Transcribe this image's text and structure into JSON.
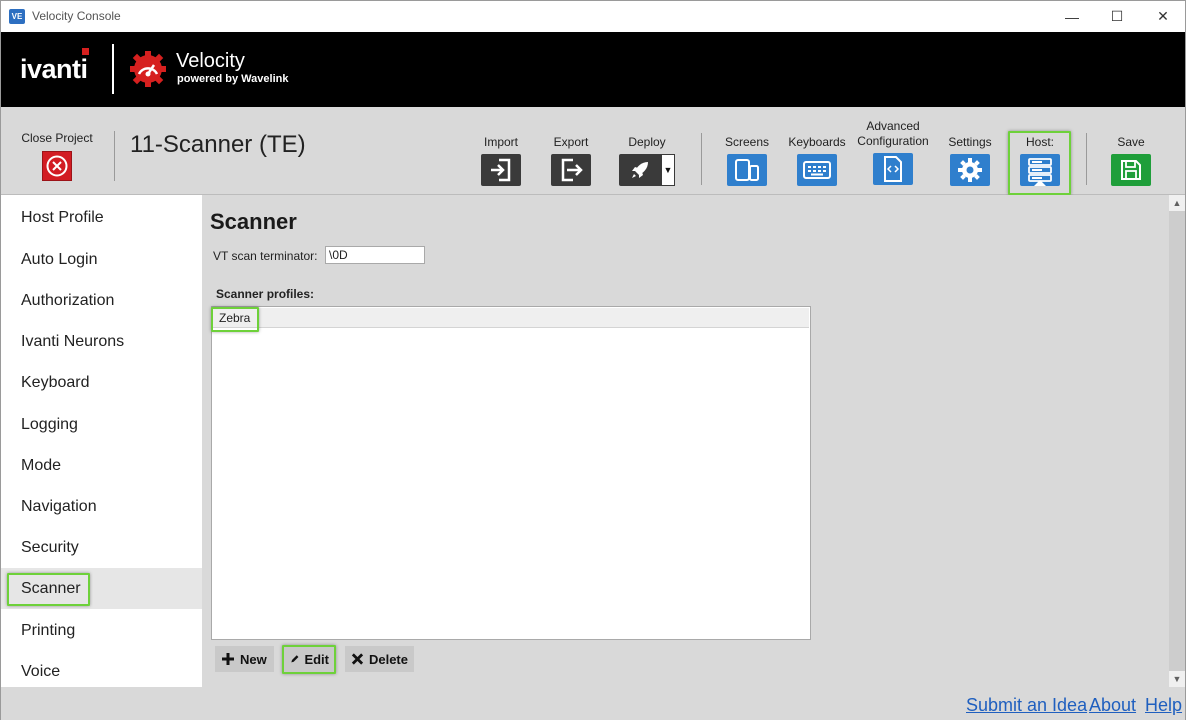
{
  "window": {
    "app_icon_text": "VE",
    "title": "Velocity Console",
    "controls": {
      "minimize": "—",
      "maximize": "☐",
      "close": "✕"
    }
  },
  "banner": {
    "brand": "ivanti",
    "product_name": "Velocity",
    "product_tagline": "powered by Wavelink",
    "accent_color": "#d6201f"
  },
  "toolbar": {
    "close_project_label": "Close Project",
    "project_title": "11-Scanner (TE)",
    "import_label": "Import",
    "export_label": "Export",
    "deploy_label": "Deploy",
    "screens_label": "Screens",
    "keyboards_label": "Keyboards",
    "advanced_label_1": "Advanced",
    "advanced_label_2": "Configuration",
    "settings_label": "Settings",
    "host_label": "Host:",
    "save_label": "Save"
  },
  "sidebar": {
    "items": [
      {
        "label": "Host Profile"
      },
      {
        "label": "Auto Login"
      },
      {
        "label": "Authorization"
      },
      {
        "label": "Ivanti Neurons"
      },
      {
        "label": "Keyboard"
      },
      {
        "label": "Logging"
      },
      {
        "label": "Mode"
      },
      {
        "label": "Navigation"
      },
      {
        "label": "Security"
      },
      {
        "label": "Scanner"
      },
      {
        "label": "Printing"
      },
      {
        "label": "Voice"
      }
    ],
    "active_item": "Scanner"
  },
  "main": {
    "section_title": "Scanner",
    "vt_scan_terminator_label": "VT scan terminator:",
    "vt_scan_terminator_value": "\\0D",
    "profiles_label": "Scanner profiles:",
    "profiles": [
      {
        "name": "Zebra"
      }
    ],
    "buttons": {
      "new_label": "New",
      "edit_label": "Edit",
      "delete_label": "Delete"
    }
  },
  "footer": {
    "submit_idea": "Submit an Idea",
    "about": "About",
    "help": "Help"
  },
  "colors": {
    "highlight": "#6ed13a",
    "toolbar_bg": "#d9d9d9",
    "tool_blue": "#2f7fcd",
    "tool_dark": "#3a3a3a",
    "save_green": "#1f9e3a",
    "close_red": "#d21c23",
    "link_blue": "#1f5fbf"
  },
  "icons": {
    "import": "import-icon",
    "export": "export-icon",
    "deploy": "rocket-icon",
    "screens": "devices-icon",
    "keyboards": "keyboard-icon",
    "advanced": "code-file-icon",
    "settings": "gear-icon",
    "host": "server-icon",
    "save": "floppy-disk-icon",
    "close_project": "close-circle-icon"
  }
}
